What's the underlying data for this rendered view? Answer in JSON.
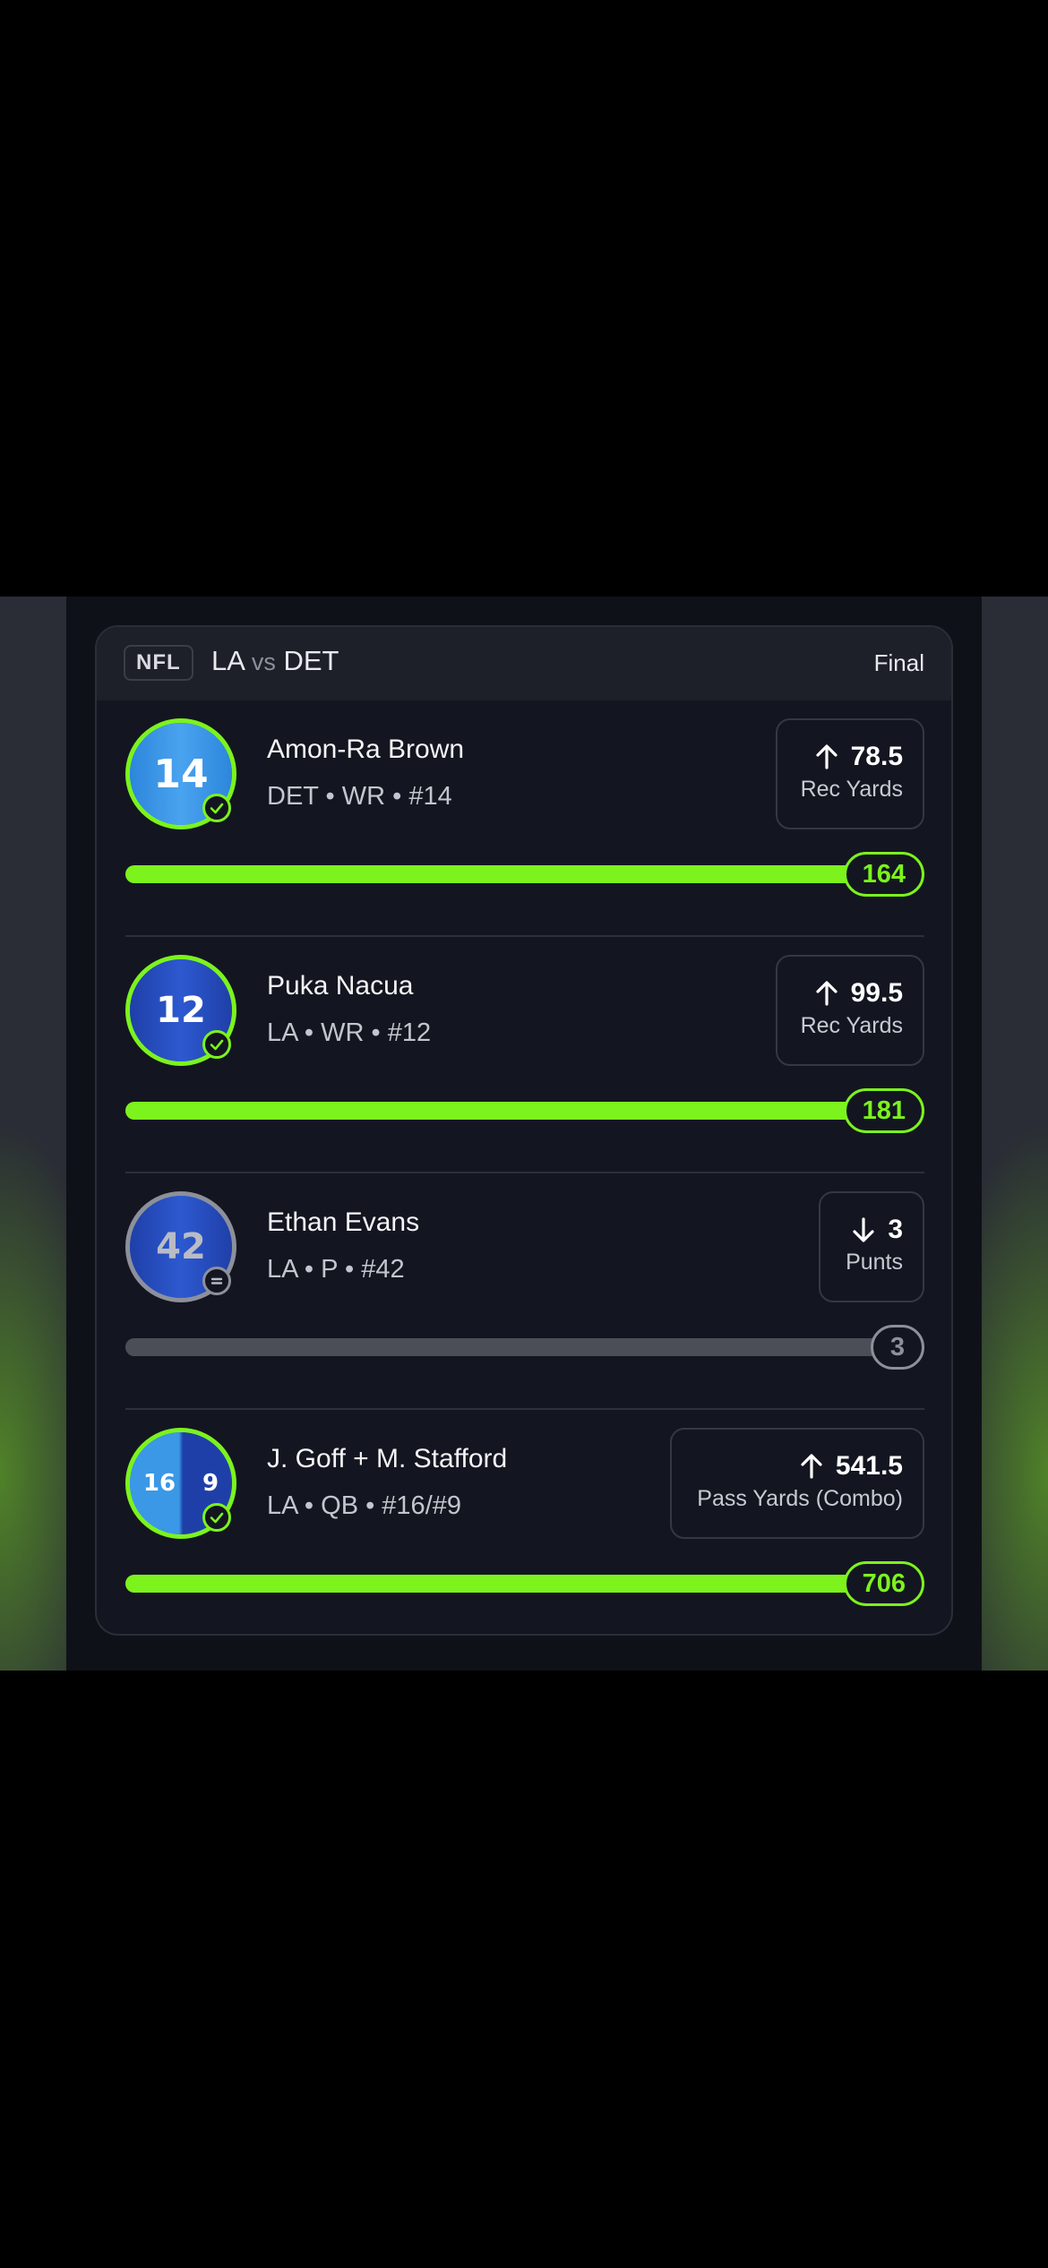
{
  "header": {
    "league": "NFL",
    "team_a": "LA",
    "vs": "vs",
    "team_b": "DET",
    "status": "Final"
  },
  "colors": {
    "accent": "#7cf31d",
    "neutral": "#8d909a",
    "card": "#131620"
  },
  "players": [
    {
      "name": "Amon-Ra Brown",
      "meta": "DET • WR • #14",
      "jersey_number": "14",
      "direction": "up",
      "line": "78.5",
      "stat": "Rec Yards",
      "actual": "164",
      "progress": 1.0,
      "result": "hit",
      "result_icon": "check-icon"
    },
    {
      "name": "Puka Nacua",
      "meta": "LA • WR • #12",
      "jersey_number": "12",
      "direction": "up",
      "line": "99.5",
      "stat": "Rec Yards",
      "actual": "181",
      "progress": 1.0,
      "result": "hit",
      "result_icon": "check-icon"
    },
    {
      "name": "Ethan Evans",
      "meta": "LA • P • #42",
      "jersey_number": "42",
      "direction": "down",
      "line": "3",
      "stat": "Punts",
      "actual": "3",
      "progress": 1.0,
      "result": "push",
      "result_icon": "equals-icon"
    },
    {
      "name": "J. Goff + M. Stafford",
      "meta": "LA • QB • #16/#9",
      "jersey_number": "16",
      "jersey_number_2": "9",
      "direction": "up",
      "line": "541.5",
      "stat": "Pass Yards (Combo)",
      "actual": "706",
      "progress": 1.0,
      "result": "hit",
      "result_icon": "check-icon"
    }
  ]
}
